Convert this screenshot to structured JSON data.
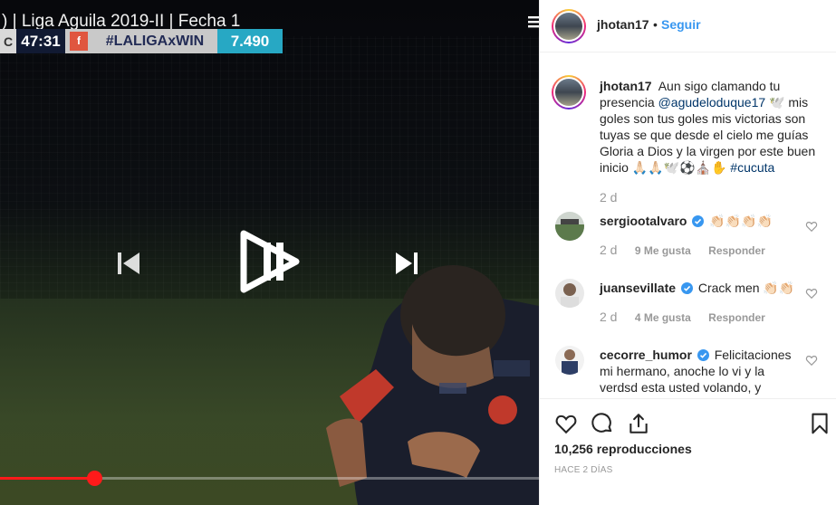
{
  "video": {
    "title": ") | Liga Aguila 2019-II | Fecha 1",
    "scorebar": {
      "tag": "C",
      "clock": "47:31",
      "logo_letter": "f",
      "hashtag": "#LALIGAxWIN",
      "odds": "7.490"
    },
    "progress": 0.175
  },
  "post": {
    "author": "jhotan17",
    "follow_label": "Seguir",
    "dot": "•",
    "caption_user": "jhotan17",
    "caption_text_1": "Aun sigo clamando tu presencia",
    "caption_mention": "@agudeloduque17",
    "caption_text_2": "🕊️ mis goles son tus goles mis victorias son tuyas se que desde el cielo me guías Gloria a Dios y la virgen por este buen inicio 🙏🏻🙏🏻🕊️⚽️⛪️✋",
    "caption_hashtag": "#cucuta",
    "caption_time": "2 d",
    "comments": [
      {
        "user": "sergiootalvaro",
        "text": "👏🏻👏🏻👏🏻👏🏻",
        "time": "2 d",
        "likes": "9 Me gusta",
        "reply": "Responder"
      },
      {
        "user": "juansevillate",
        "text": "Crack men 👏🏻👏🏻",
        "time": "2 d",
        "likes": "4 Me gusta",
        "reply": "Responder"
      },
      {
        "user": "cecorre_humor",
        "text": "Felicitaciones mi hermano, anoche lo vi y la verdsd esta usted volando, y",
        "time": "",
        "likes": "",
        "reply": ""
      }
    ],
    "views": "10,256 reproducciones",
    "posted_ago": "HACE 2 DÍAS"
  },
  "colors": {
    "accent": "#3897f0",
    "progress": "#ff1a1a",
    "verified": "#3897f0",
    "odds_bg": "#27a8c4",
    "clock_bg": "#111a33"
  }
}
